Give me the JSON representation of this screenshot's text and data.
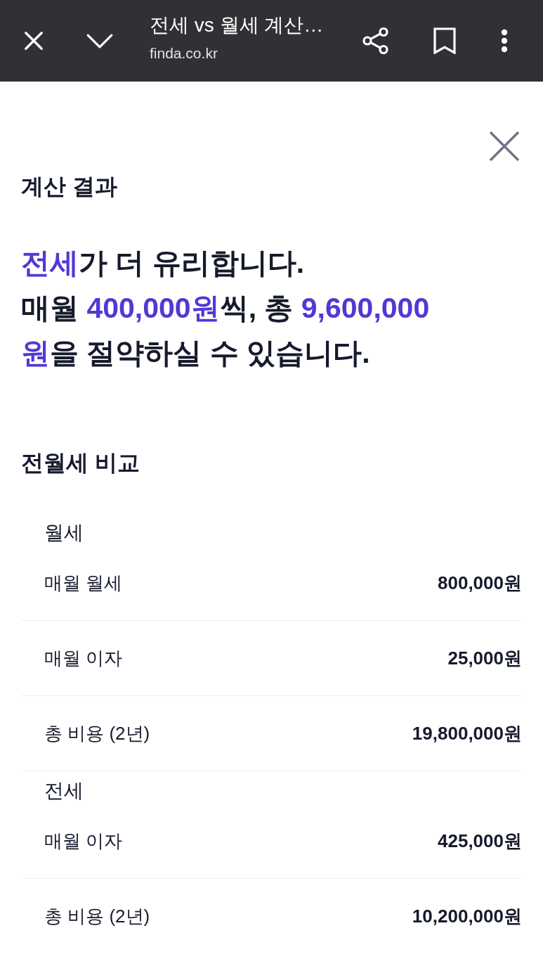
{
  "browser_bar": {
    "title": "전세 vs 월세 계산…",
    "url": "finda.co.kr"
  },
  "result": {
    "heading": "계산 결과",
    "headline": [
      [
        {
          "text": "전세",
          "highlight": true
        },
        {
          "text": "가 더 유리합니다.",
          "highlight": false
        }
      ],
      [
        {
          "text": "매월 ",
          "highlight": false
        },
        {
          "text": "400,000원",
          "highlight": true
        },
        {
          "text": "씩, 총 ",
          "highlight": false
        },
        {
          "text": "9,600,000",
          "highlight": true
        }
      ],
      [
        {
          "text": "원",
          "highlight": true
        },
        {
          "text": "을 절약하실 수 있습니다.",
          "highlight": false
        }
      ]
    ]
  },
  "comparison": {
    "heading": "전월세 비교",
    "groups": [
      {
        "title": "월세",
        "rows": [
          {
            "label": "매월 월세",
            "value": "800,000원"
          },
          {
            "label": "매월 이자",
            "value": "25,000원"
          },
          {
            "label": "총 비용 (2년)",
            "value": "19,800,000원"
          }
        ]
      },
      {
        "title": "전세",
        "rows": [
          {
            "label": "매월 이자",
            "value": "425,000원"
          },
          {
            "label": "총 비용 (2년)",
            "value": "10,200,000원"
          }
        ]
      }
    ]
  }
}
